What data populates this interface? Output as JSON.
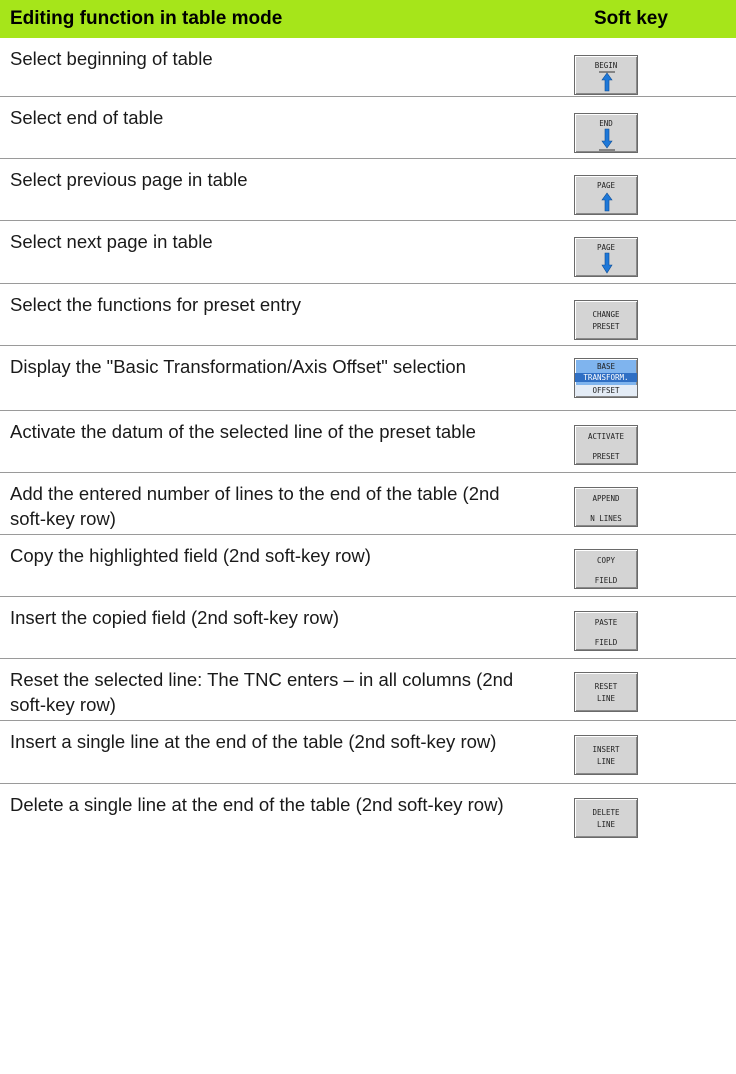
{
  "header": {
    "function_col": "Editing function in table mode",
    "softkey_col": "Soft key"
  },
  "rows": [
    {
      "text": "Select beginning of table",
      "key": {
        "line1": "BEGIN",
        "icon": "arrow-up-with-bar-icon"
      }
    },
    {
      "text": "Select end of table",
      "key": {
        "line1": "END",
        "icon": "arrow-down-with-bar-icon"
      }
    },
    {
      "text": "Select previous page in table",
      "key": {
        "line1": "PAGE",
        "icon": "arrow-up-icon"
      }
    },
    {
      "text": "Select next page in table",
      "key": {
        "line1": "PAGE",
        "icon": "arrow-down-icon"
      }
    },
    {
      "text": "Select the functions for preset entry",
      "key": {
        "line1": "CHANGE",
        "line2": "PRESET"
      }
    },
    {
      "text": "Display the \"Basic Transformation/Axis Offset\" selection",
      "key": {
        "line1": "BASE",
        "line2": "TRANSFORM.",
        "line3": "OFFSET"
      }
    },
    {
      "text": "Activate the datum of the selected line of the preset table",
      "key": {
        "line1": "ACTIVATE",
        "line2": "PRESET"
      }
    },
    {
      "text": "Add the entered number of lines to the end of the table (2nd soft-key row)",
      "key": {
        "line1": "APPEND",
        "line2": "N LINES"
      }
    },
    {
      "text": "Copy the highlighted field (2nd soft-key row)",
      "key": {
        "line1": "COPY",
        "line2": "FIELD"
      }
    },
    {
      "text": "Insert the copied field (2nd soft-key row)",
      "key": {
        "line1": "PASTE",
        "line2": "FIELD"
      }
    },
    {
      "text": "Reset the selected line: The TNC enters – in all columns (2nd soft-key row)",
      "key": {
        "line1": "RESET",
        "line2": "LINE"
      }
    },
    {
      "text": "Insert a single line at the end of the table (2nd soft-key row)",
      "key": {
        "line1": "INSERT",
        "line2": "LINE"
      }
    },
    {
      "text": "Delete a single line at the end of the table (2nd soft-key row)",
      "key": {
        "line1": "DELETE",
        "line2": "LINE"
      }
    }
  ],
  "colors": {
    "header_bg": "#a6e51a",
    "softkey_bg": "#d4d4d4",
    "arrow_blue": "#1e78d8",
    "base_key_bg": "#7fb4ee"
  }
}
